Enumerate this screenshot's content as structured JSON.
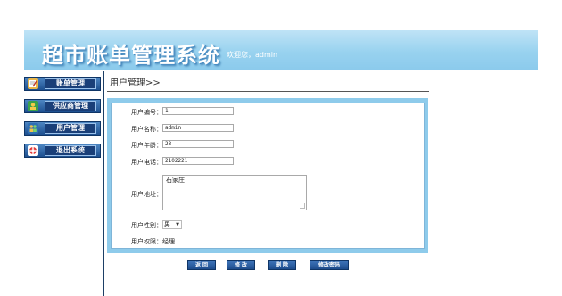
{
  "header": {
    "title": "超市账单管理系统",
    "welcome": "欢迎您，admin"
  },
  "nav": {
    "items": [
      {
        "label": "账单管理",
        "icon": "note-edit-icon"
      },
      {
        "label": "供应商管理",
        "icon": "supplier-icon"
      },
      {
        "label": "用户管理",
        "icon": "users-icon"
      },
      {
        "label": "退出系统",
        "icon": "lifebuoy-icon"
      }
    ]
  },
  "page": {
    "title": "用户管理>>"
  },
  "form": {
    "user_code": {
      "label": "用户编号：",
      "value": "1"
    },
    "user_name": {
      "label": "用户名称：",
      "value": "admin"
    },
    "user_age": {
      "label": "用户年龄：",
      "value": "23"
    },
    "user_phone": {
      "label": "用户电话：",
      "value": "2102221"
    },
    "user_address": {
      "label": "用户地址：",
      "value": "石家庄"
    },
    "user_gender": {
      "label": "用户性别：",
      "value": "男"
    },
    "user_role": {
      "label": "用户权限：",
      "value": "经理"
    }
  },
  "actions": {
    "back": "返 回",
    "modify": "修 改",
    "delete": "删 除",
    "change_password": "修改密码"
  },
  "colors": {
    "banner": "#98d2ef",
    "nav_bg": "#1d4f8f",
    "panel_border": "#8ecbeb"
  }
}
